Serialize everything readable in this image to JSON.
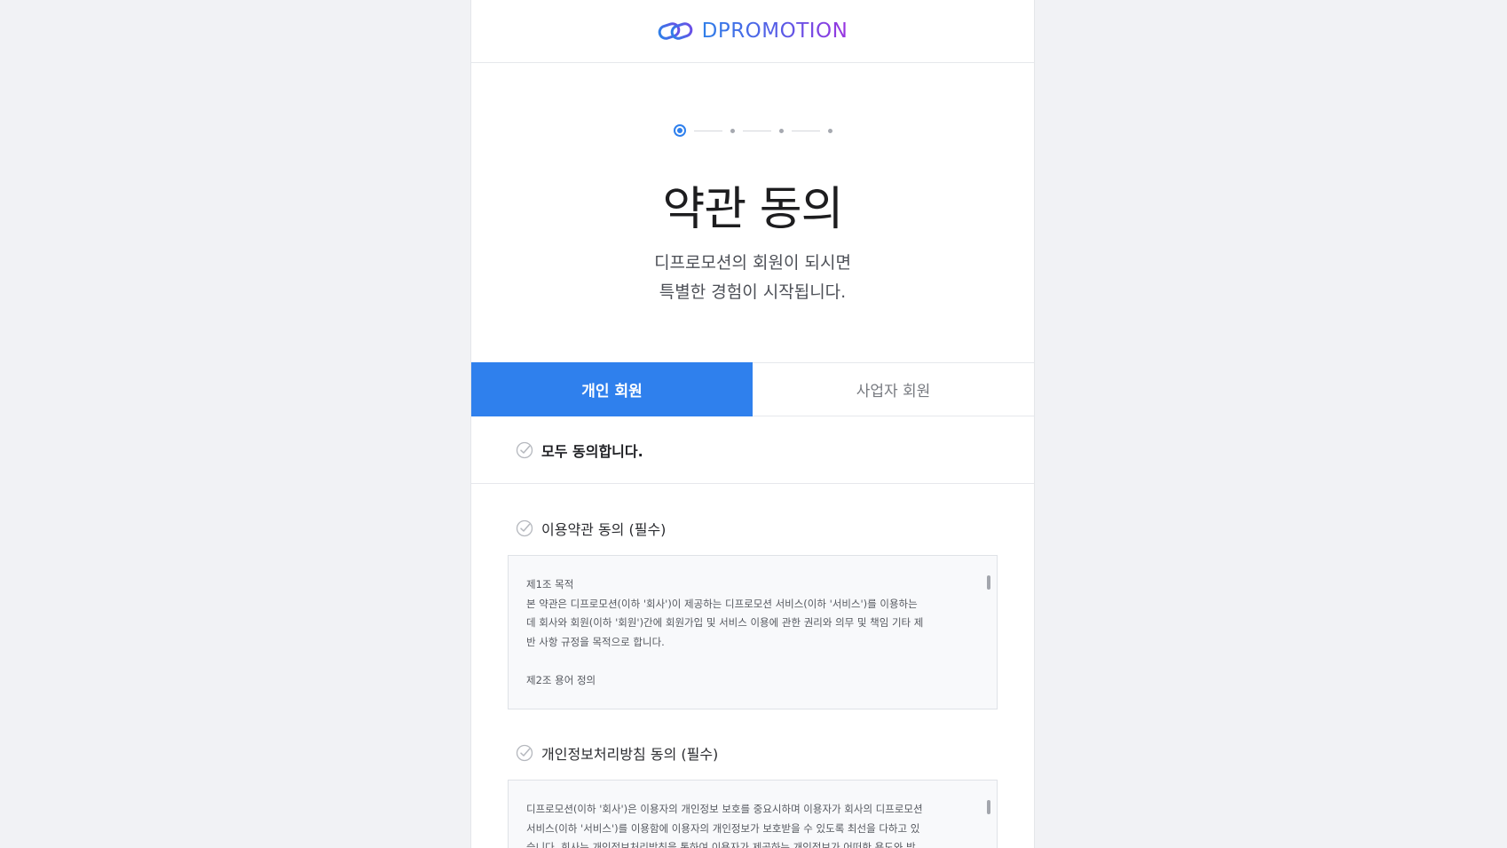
{
  "brand": {
    "name": "DPROMOTION",
    "logo_icon": "chain-link-icon",
    "gradient_start": "#2f7fe8",
    "gradient_end": "#9a35e0"
  },
  "progress": {
    "total_steps": 4,
    "current_step": 1
  },
  "page": {
    "title": "약관 동의",
    "subtitle_line1": "디프로모션의 회원이 되시면",
    "subtitle_line2": "특별한 경험이 시작됩니다."
  },
  "tabs": [
    {
      "label": "개인 회원",
      "active": true
    },
    {
      "label": "사업자 회원",
      "active": false
    }
  ],
  "agree_all": {
    "label": "모두 동의합니다."
  },
  "terms": [
    {
      "label": "이용약관 동의 (필수)",
      "content": {
        "heading1": "제1조 목적",
        "body1": "본 약관은 디프로모션(이하 '회사')이 제공하는 디프로모션 서비스(이하 '서비스')를 이용하는\n데 회사와 회원(이하 '회원')간에 회원가입 및 서비스 이용에 관한 권리와 의무 및 책임 기타 제\n반 사항 규정을 목적으로 합니다.",
        "heading2": "제2조 용어 정의"
      }
    },
    {
      "label": "개인정보처리방침 동의 (필수)",
      "content": {
        "body1": "디프로모션(이하 '회사')은 이용자의 개인정보 보호를 중요시하며 이용자가 회사의 디프로모션\n서비스(이하 '서비스')를 이용함에 이용자의 개인정보가 보호받을 수 있도록 최선을 다하고 있\n습니다. 회사는 개인정보처리방침을 통하여 이용자가 제공하는 개인정보가 어떠한 용도와 방"
      }
    }
  ],
  "colors": {
    "accent": "#2f80ed",
    "background": "#f1f2f5"
  }
}
